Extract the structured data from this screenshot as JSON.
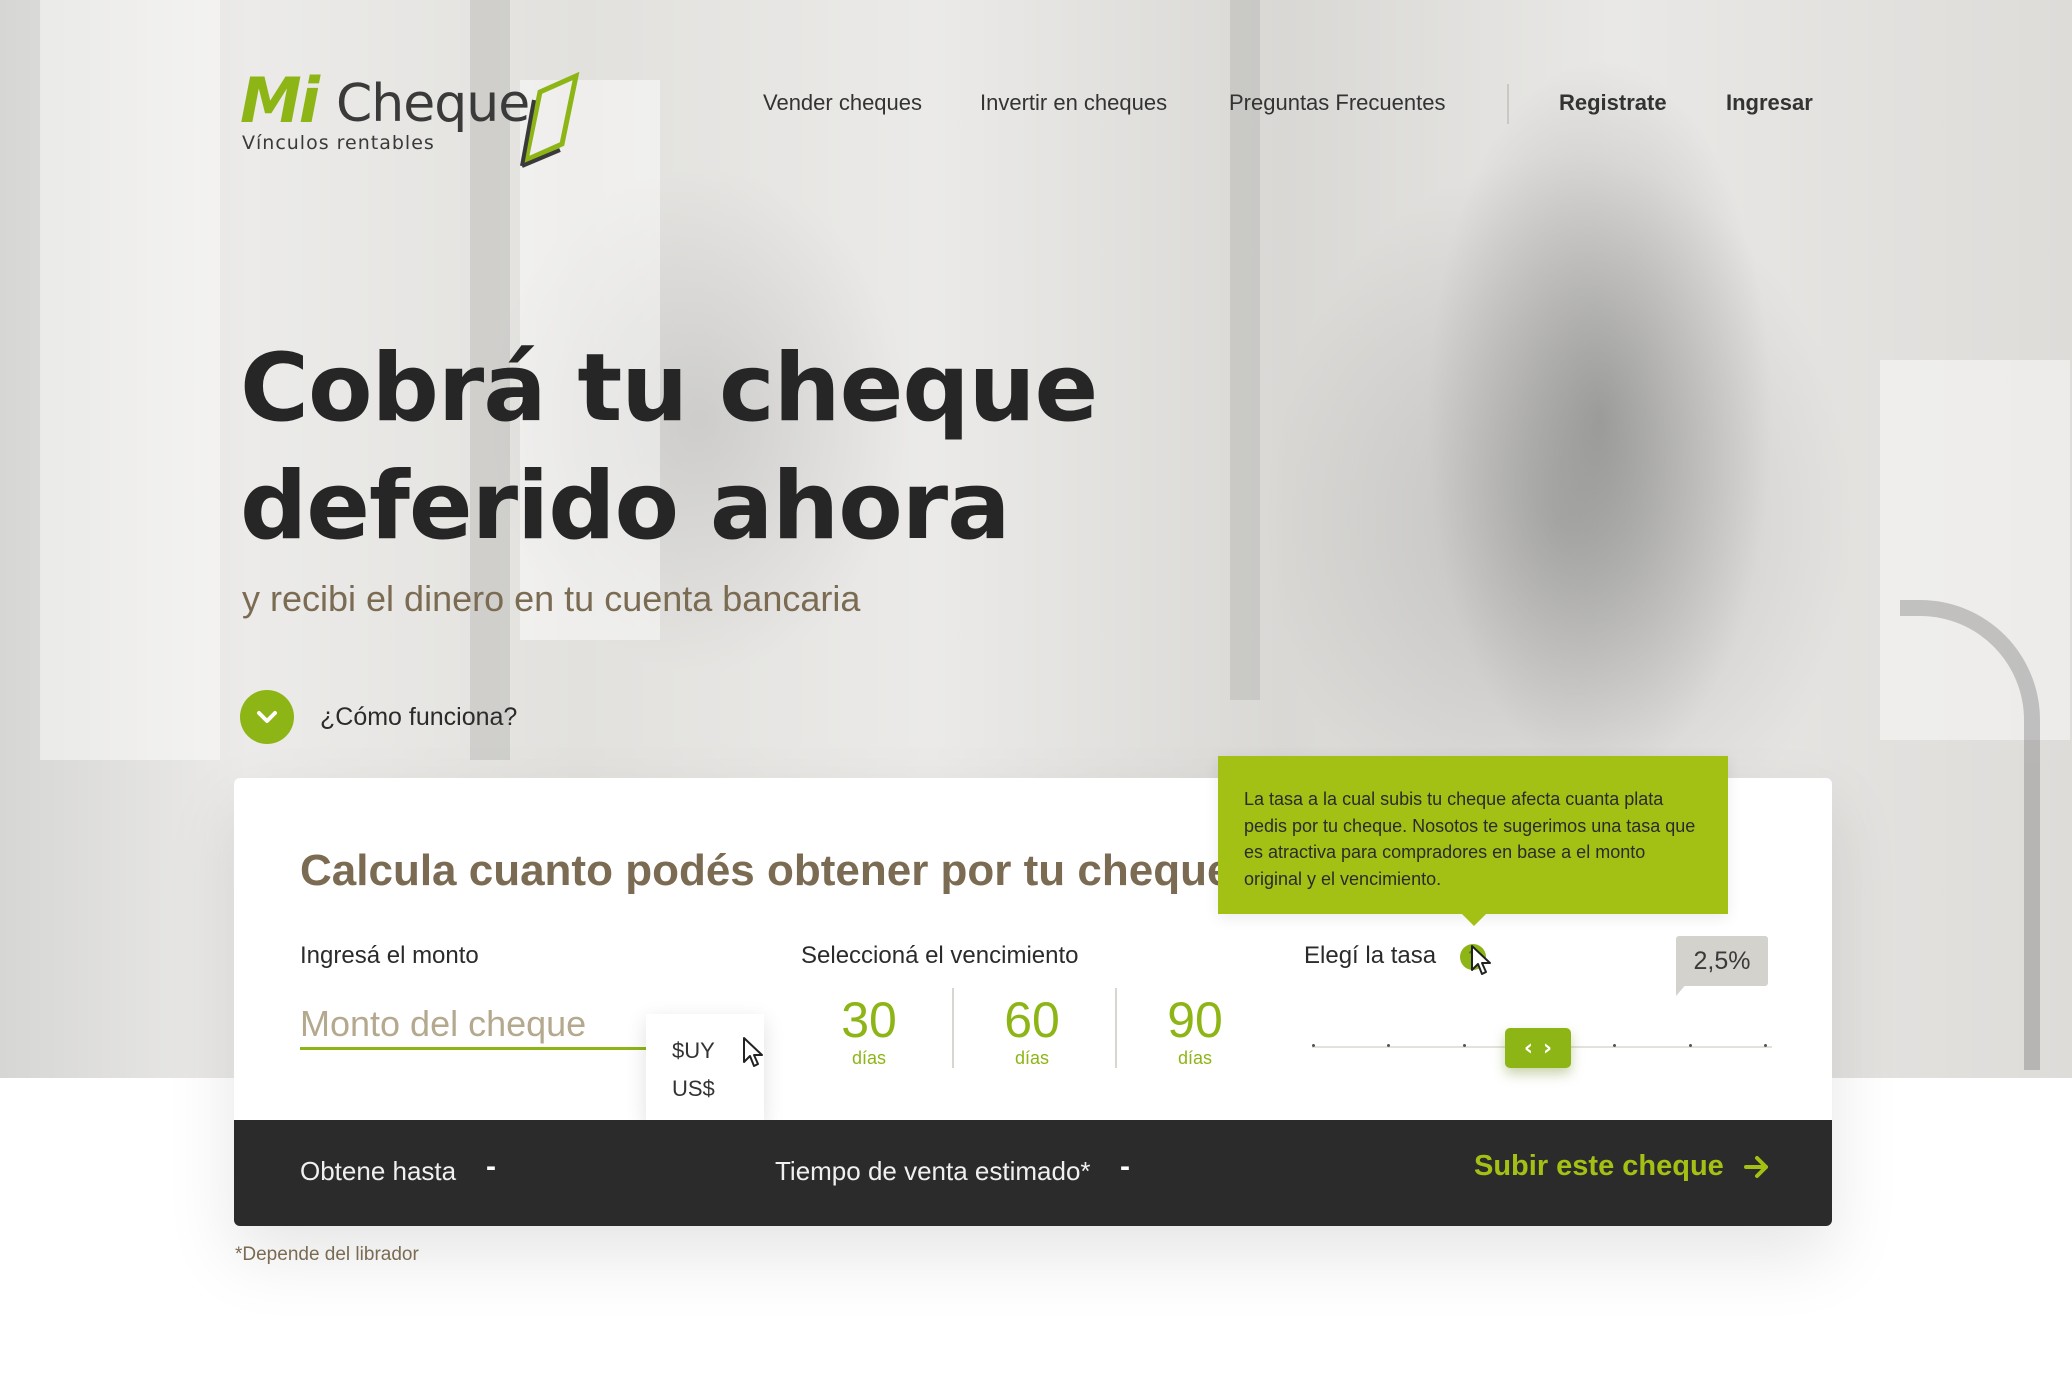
{
  "brand": {
    "logo_mi": "Mi",
    "logo_cheque": "Cheque",
    "tagline": "Vínculos rentables",
    "accent_color": "#8db516",
    "dark_color": "#2b2b2b",
    "muted_color": "#7a6b52"
  },
  "nav": {
    "items": [
      {
        "label": "Vender cheques"
      },
      {
        "label": "Invertir en cheques"
      },
      {
        "label": "Preguntas Frecuentes"
      }
    ],
    "register": "Registrate",
    "login": "Ingresar"
  },
  "hero": {
    "title_line1": "Cobrá tu cheque",
    "title_line2": "deferido ahora",
    "subtitle": "y recibi el dinero en tu cuenta bancaria",
    "how_label": "¿Cómo funciona?",
    "how_icon": "chevron-down-icon"
  },
  "calculator": {
    "title": "Calcula cuanto podés obtener por tu cheque",
    "amount": {
      "label": "Ingresá el monto",
      "placeholder": "Monto del cheque",
      "value": "",
      "currencies": [
        "$UY",
        "US$"
      ]
    },
    "due": {
      "label": "Seleccioná el vencimiento",
      "options": [
        {
          "number": "30",
          "unit": "días"
        },
        {
          "number": "60",
          "unit": "días"
        },
        {
          "number": "90",
          "unit": "días"
        }
      ]
    },
    "rate": {
      "label": "Elegí la tasa",
      "info_icon_glyph": "?",
      "value": "2,5%",
      "slider_ticks": 7,
      "slider_position": 0.5,
      "tooltip": "La tasa a la cual subis tu cheque afecta cuanta plata pedis por tu cheque. Nosotos te sugerimos una tasa que es atractiva para compradores en base a el monto original y el vencimiento."
    },
    "result": {
      "obtain_label": "Obtene hasta",
      "obtain_value": "-",
      "time_label": "Tiempo de venta estimado*",
      "time_value": "-",
      "upload_label": "Subir este cheque"
    },
    "footnote": "*Depende del librador"
  }
}
